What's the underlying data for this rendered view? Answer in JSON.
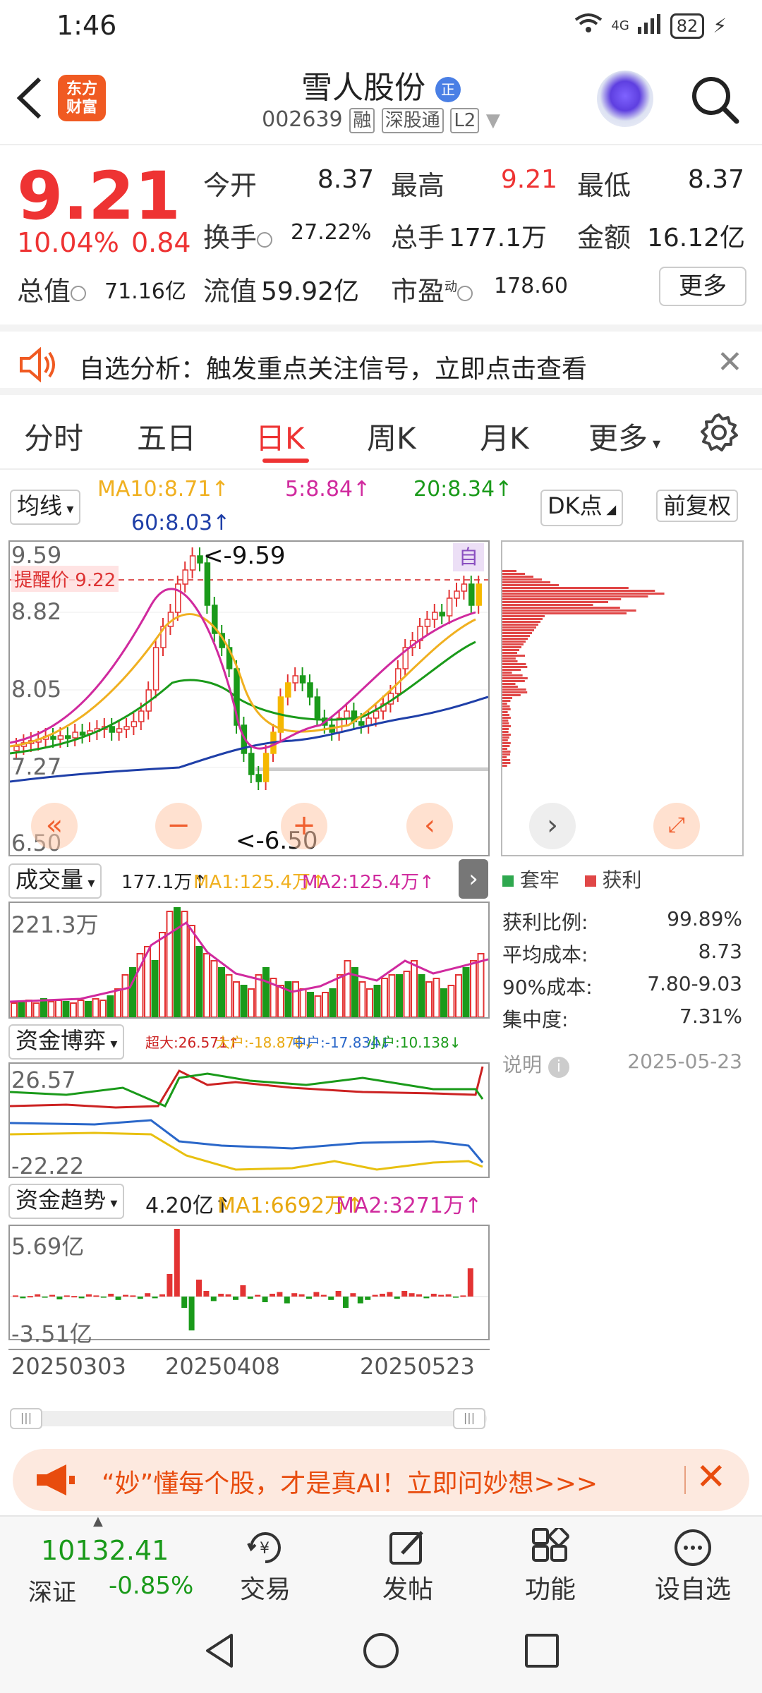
{
  "status_bar": {
    "time": "1:46",
    "network": "4G",
    "battery": "82"
  },
  "header": {
    "title": "雪人股份",
    "title_badge": "正",
    "code": "002639",
    "tags": [
      "融",
      "深股通",
      "L2"
    ],
    "logo_line1": "东方",
    "logo_line2": "财富"
  },
  "quote": {
    "price": "9.21",
    "change_pct": "10.04%",
    "change": "0.84",
    "open_label": "今开",
    "open": "8.37",
    "high_label": "最高",
    "high": "9.21",
    "low_label": "最低",
    "low": "8.37",
    "turnover_label": "换手",
    "turnover": "27.22%",
    "volume_label": "总手",
    "volume": "177.1万",
    "amount_label": "金额",
    "amount": "16.12亿",
    "mcap_label": "总值",
    "mcap": "71.16亿",
    "float_label": "流值",
    "float": "59.92亿",
    "pe_label": "市盈",
    "pe_sup": "动",
    "pe": "178.60",
    "more": "更多"
  },
  "alert": {
    "text": "自选分析：触发重点关注信号，立即点击查看"
  },
  "tabs": [
    "分时",
    "五日",
    "日K",
    "周K",
    "月K",
    "更多"
  ],
  "active_tab": 2,
  "kline": {
    "ma_selector": "均线",
    "ma10": "MA10:8.71↑",
    "ma5": "5:8.84↑",
    "ma20": "20:8.34↑",
    "ma60": "60:8.03↑",
    "dk": "DK点",
    "adjust": "前复权",
    "y_top": "9.59",
    "y_mid1": "8.82",
    "y_mid2": "8.05",
    "y_mid3": "7.27",
    "y_bottom": "6.50",
    "high_mark": "<-9.59",
    "low_mark": "<-6.50",
    "alert_price": "提醒价 9.22",
    "zi": "自"
  },
  "chip": {
    "legend_trapped": "套牢",
    "legend_profit": "获利",
    "rows": [
      {
        "label": "获利比例:",
        "value": "99.89%"
      },
      {
        "label": "平均成本:",
        "value": "8.73"
      },
      {
        "label": "90%成本:",
        "value": "7.80-9.03"
      },
      {
        "label": "集中度:",
        "value": "7.31%"
      }
    ],
    "note": "说明",
    "date": "2025-05-23"
  },
  "volume": {
    "selector": "成交量",
    "value": "177.1万↑",
    "ma1": "MA1:125.4万↑",
    "ma2": "MA2:125.4万↑",
    "y_top": "221.3万"
  },
  "funds_game": {
    "selector": "资金博弈",
    "super": "超大:26.571↑",
    "big": "大户:-18.876↓",
    "mid": "中户:-17.834↓",
    "small": "小户:10.138↓",
    "y_top": "26.57",
    "y_bottom": "-22.22"
  },
  "funds_trend": {
    "selector": "资金趋势",
    "value": "4.20亿↑",
    "ma1": "MA1:6692万↑",
    "ma2": "MA2:3271万↑",
    "y_top": "5.69亿",
    "y_bottom": "-3.51亿"
  },
  "x_axis": [
    "20250303",
    "20250408",
    "20250523"
  ],
  "promo": {
    "text": "“妙”懂每个股，才是真AI！立即问妙想>>>"
  },
  "toolbar": {
    "index_value": "10132.41",
    "index_name": "深证",
    "index_change": "-0.85%",
    "items": [
      "交易",
      "发帖",
      "功能",
      "设自选"
    ]
  },
  "colors": {
    "up": "#e33333",
    "down": "#1a9a1a",
    "accent": "#f05a22"
  }
}
